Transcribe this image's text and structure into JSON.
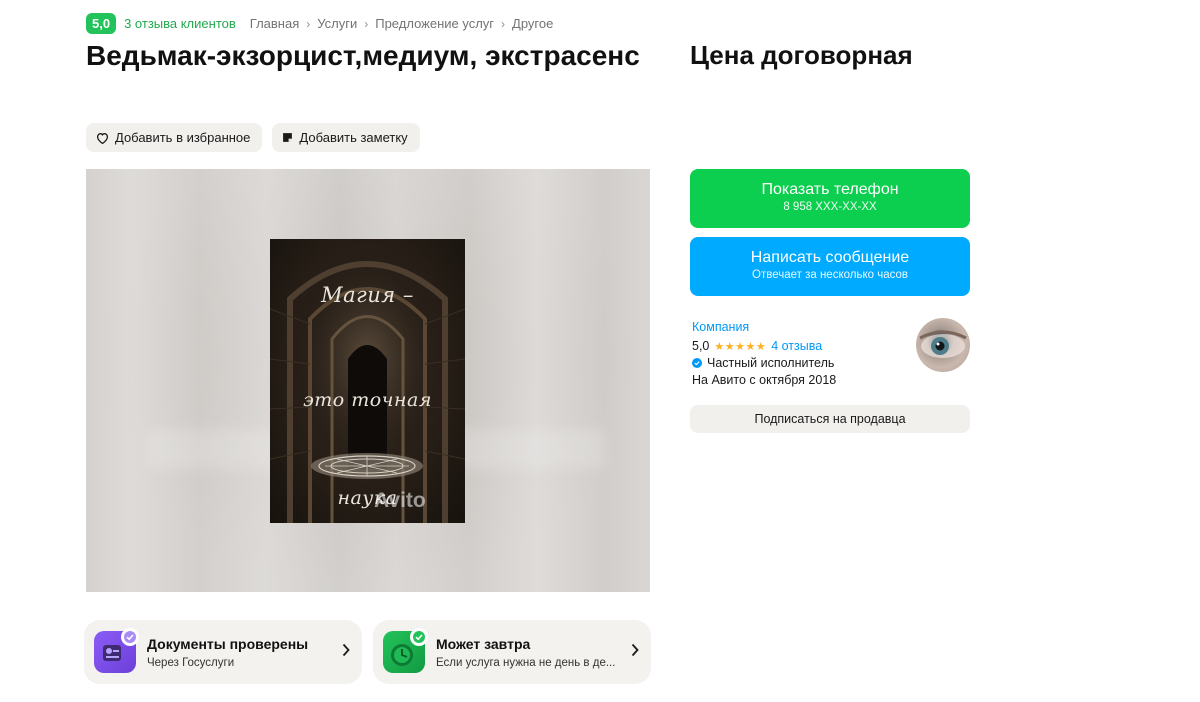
{
  "header": {
    "rating": "5,0",
    "reviews_link": "3 отзыва клиентов",
    "breadcrumbs": [
      "Главная",
      "Услуги",
      "Предложение услуг",
      "Другое"
    ]
  },
  "title": "Ведьмак-экзорцист,медиум, экстрасенс",
  "actions": {
    "favorite": "Добавить в избранное",
    "note": "Добавить заметку"
  },
  "gallery": {
    "poster_lines": [
      "Магия –",
      "это точная",
      "наука"
    ],
    "watermark": "Avito"
  },
  "features": [
    {
      "title": "Документы проверены",
      "subtitle": "Через Госуслуги",
      "icon": "document-check-icon"
    },
    {
      "title": "Может завтра",
      "subtitle": "Если услуга нужна не день в де...",
      "icon": "clock-check-icon"
    }
  ],
  "price": "Цена договорная",
  "phone_button": {
    "label": "Показать телефон",
    "number": "8 958 XXX-XX-XX"
  },
  "message_button": {
    "label": "Написать сообщение",
    "subtitle": "Отвечает за несколько часов"
  },
  "seller": {
    "type": "Компания",
    "rating": "5,0",
    "stars": "★★★★★",
    "reviews": "4 отзыва",
    "badge": "Частный исполнитель",
    "since": "На Авито с октября 2018"
  },
  "subscribe": "Подписаться на продавца",
  "colors": {
    "green": "#0ccf4f",
    "blue": "#00aaff",
    "link_blue": "#0099f7",
    "star": "#ffb021",
    "badge_green": "#22c35a",
    "chip_bg": "#f2f0ec"
  }
}
